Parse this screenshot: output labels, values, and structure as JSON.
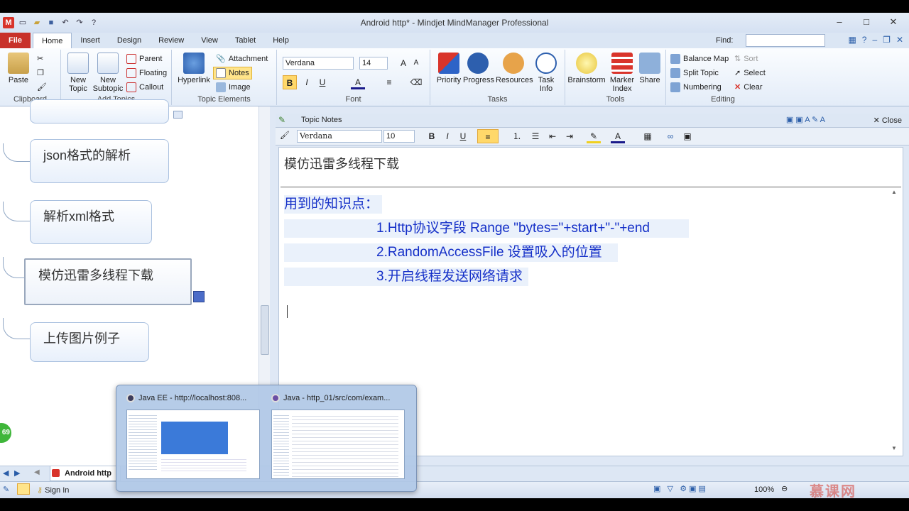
{
  "window": {
    "title": "Android http* - Mindjet MindManager Professional",
    "app_badge": "M"
  },
  "qat": {
    "undo": "↶",
    "redo": "↷",
    "help": "?"
  },
  "tabs": {
    "file": "File",
    "items": [
      "Home",
      "Insert",
      "Design",
      "Review",
      "View",
      "Tablet",
      "Help"
    ],
    "active": "Home",
    "find_label": "Find:"
  },
  "ribbon": {
    "clipboard": {
      "group": "Clipboard",
      "paste": "Paste"
    },
    "add_topics": {
      "group": "Add Topics",
      "new_topic_1": "New",
      "new_topic_2": "Topic",
      "new_subtopic_1": "New",
      "new_subtopic_2": "Subtopic",
      "parent": "Parent",
      "floating": "Floating",
      "callout": "Callout"
    },
    "topic_elements": {
      "group": "Topic Elements",
      "hyperlink": "Hyperlink",
      "attachment": "Attachment",
      "notes": "Notes",
      "image": "Image"
    },
    "font": {
      "group": "Font",
      "family": "Verdana",
      "size": "14",
      "bold": "B",
      "italic": "I",
      "underline": "U"
    },
    "tasks": {
      "group": "Tasks",
      "priority": "Priority",
      "progress": "Progress",
      "resources": "Resources",
      "task_info_1": "Task",
      "task_info_2": "Info"
    },
    "tools": {
      "group": "Tools",
      "brainstorm": "Brainstorm",
      "marker_1": "Marker",
      "marker_2": "Index",
      "share": "Share"
    },
    "editing": {
      "group": "Editing",
      "balance_map": "Balance Map",
      "split_topic": "Split Topic",
      "numbering": "Numbering",
      "sort": "Sort",
      "select": "Select",
      "clear": "Clear"
    }
  },
  "map": {
    "topics": [
      "json格式的解析",
      "解析xml格式",
      "模仿迅雷多线程下载",
      "上传图片例子"
    ]
  },
  "notes": {
    "header": "Topic Notes",
    "close": "Close",
    "toolbar": {
      "font": "Verdana",
      "size": "10",
      "bold": "B",
      "italic": "I",
      "underline": "U"
    },
    "title": "模仿迅雷多线程下载",
    "lines": [
      "用到的知识点：",
      "1.Http协议字段 Range \"bytes=\"+start+\"-\"+end",
      "2.RandomAccessFile 设置吸入的位置",
      "3.开启线程发送网络请求"
    ]
  },
  "bottom": {
    "doc_tab": "Android http",
    "sign_in": "Sign In",
    "zoom": "100%",
    "badge": "69"
  },
  "preview": {
    "items": [
      {
        "title": "Java EE - http://localhost:808..."
      },
      {
        "title": "Java - http_01/src/com/exam..."
      }
    ]
  },
  "watermark": "慕课网",
  "colors": {
    "accent": "#c8312a",
    "note_text": "#1530c8",
    "highlight": "#eaf1fb"
  }
}
